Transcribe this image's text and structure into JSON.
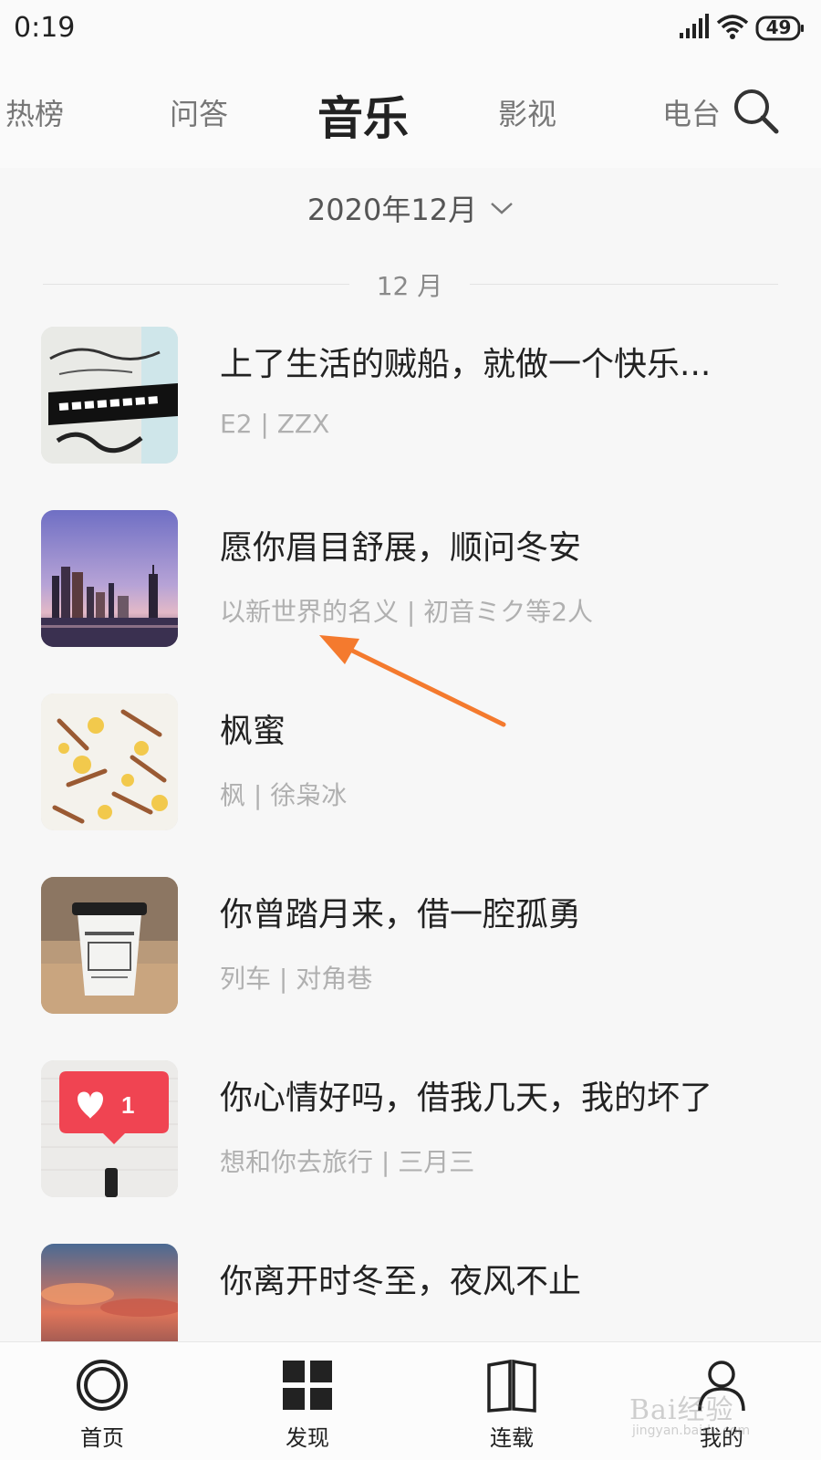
{
  "status_bar": {
    "time": "0:19",
    "battery": "49",
    "icons": [
      "signal-icon",
      "wifi-icon",
      "battery-icon"
    ]
  },
  "top_tabs": {
    "items": [
      {
        "label": "热榜",
        "active": false
      },
      {
        "label": "问答",
        "active": false
      },
      {
        "label": "音乐",
        "active": true
      },
      {
        "label": "影视",
        "active": false
      },
      {
        "label": "电台",
        "active": false
      }
    ],
    "search_icon": "search-icon"
  },
  "month_picker": {
    "label": "2020年12月",
    "icon": "chevron-down-icon"
  },
  "section": {
    "label": "12 月"
  },
  "songs": [
    {
      "title": "上了生活的贼船，就做一个快乐...",
      "meta": "E2 | ZZX",
      "thumb": "lettering-notebook"
    },
    {
      "title": "愿你眉目舒展，顺问冬安",
      "meta": "以新世界的名义 | 初音ミク等2人",
      "thumb": "city-skyline"
    },
    {
      "title": "枫蜜",
      "meta": "枫 | 徐枭冰",
      "thumb": "cinnamon-lemon"
    },
    {
      "title": "你曾踏月来，借一腔孤勇",
      "meta": "列车 | 对角巷",
      "thumb": "coffee-cup"
    },
    {
      "title": "你心情好吗，借我几天，我的坏了",
      "meta": "想和你去旅行 | 三月三",
      "thumb": "heart-notification"
    },
    {
      "title": "你离开时冬至，夜风不止",
      "meta": "",
      "thumb": "sunset-clouds"
    }
  ],
  "bottom_nav": {
    "items": [
      {
        "label": "首页",
        "icon": "home-ring-icon"
      },
      {
        "label": "发现",
        "icon": "grid-icon"
      },
      {
        "label": "连载",
        "icon": "book-icon"
      },
      {
        "label": "我的",
        "icon": "user-icon"
      }
    ]
  },
  "watermark": {
    "text": "Bai经验",
    "sub": "jingyan.baidu.com"
  },
  "colors": {
    "annotation_arrow": "#f47a2e",
    "title_text": "#222222",
    "meta_text": "#b0b0b0",
    "background": "#f7f7f7"
  }
}
